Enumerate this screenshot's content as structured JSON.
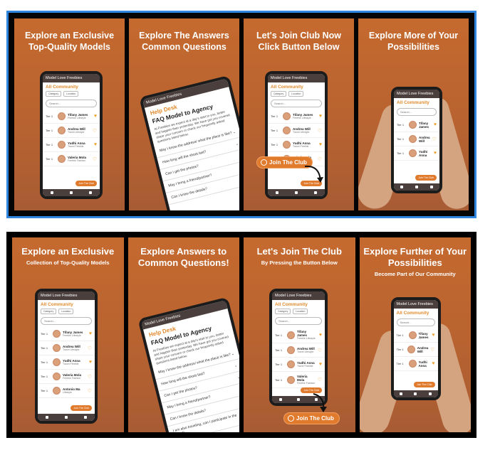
{
  "top": {
    "panels": [
      {
        "title": "Explore an Exclusive Top-Quality Models"
      },
      {
        "title": "Explore The Answers Common Questions"
      },
      {
        "title": "Let's Join Club Now Click Button Below"
      },
      {
        "title": "Explore More of Your Possibilities"
      }
    ]
  },
  "bottom": {
    "panels": [
      {
        "title": "Explore an Exclusive",
        "sub": "Collection of Top-Quality Models"
      },
      {
        "title": "Explore Answers to Common Questions!",
        "sub": ""
      },
      {
        "title": "Let's Join The Club",
        "sub": "By Pressing the Button Below"
      },
      {
        "title": "Explore Further of Your Possibilities",
        "sub": "Become Part of Our Community"
      }
    ]
  },
  "app": {
    "bar_title": "Model Love Freebies",
    "section": "All Community",
    "filter1": "Category",
    "filter2": "Location",
    "search_placeholder": "Search...",
    "tier": "Tier 1",
    "rows": [
      {
        "name": "Tifany James",
        "desc": "Freebie Lifestyle"
      },
      {
        "name": "Andrea Will",
        "desc": "Travel Lifestyle"
      },
      {
        "name": "Yudhi Anna",
        "desc": "Travel Freebie"
      },
      {
        "name": "Valeria Mola",
        "desc": "Freebie Fashion"
      },
      {
        "name": "Antonio Ma",
        "desc": "Lifestyle"
      }
    ],
    "pill": "Join The Club"
  },
  "help": {
    "desk": "Help Desk",
    "title": "FAQ Model to Agency",
    "para": "At Freebies we expect at a day's start to you, better and happier than yesterday. We have got you covered share your concern or check our frequently asked questions listed below.",
    "questions": [
      "May I know the address/ what the place is like?",
      "How long will the shoot last?",
      "Can I get the photos?",
      "May I bring a friend/partner?",
      "Can I know the details?",
      "I am also traveling, can I participate in the shoot?"
    ]
  },
  "join_label": "Join The Club",
  "colors": {
    "accent": "#e07a2c",
    "panel": "#b96330",
    "frame_blue": "#2f86e0"
  }
}
